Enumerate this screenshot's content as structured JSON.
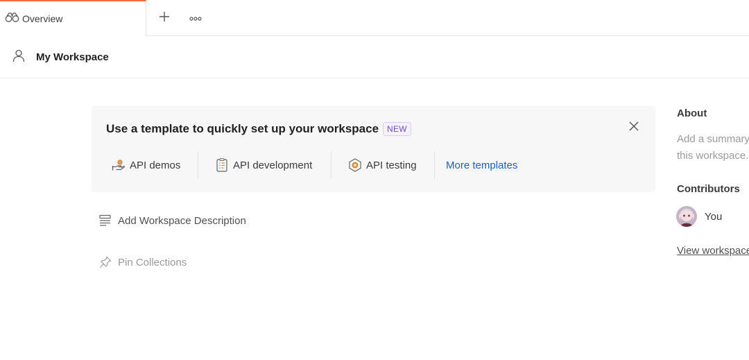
{
  "tabs": {
    "active": {
      "label": "Overview",
      "icon": "binoculars-icon"
    },
    "add_icon": "plus-icon",
    "more_icon": "ellipsis-icon"
  },
  "workspace": {
    "title": "My Workspace",
    "icon": "user-icon"
  },
  "banner": {
    "title": "Use a template to quickly set up your workspace",
    "badge": "NEW",
    "close_icon": "close-icon",
    "templates": [
      {
        "label": "API demos",
        "icon": "hand-coin-icon"
      },
      {
        "label": "API development",
        "icon": "clipboard-list-icon"
      },
      {
        "label": "API testing",
        "icon": "gear-hexagon-icon"
      }
    ],
    "more_label": "More templates"
  },
  "actions": {
    "description": {
      "label": "Add Workspace Description",
      "icon": "text-lines-icon"
    },
    "pin": {
      "label": "Pin Collections",
      "icon": "pin-icon"
    }
  },
  "sidebar": {
    "about_heading": "About",
    "about_text": "Add a summary of this workspace.",
    "contributors_heading": "Contributors",
    "contributor_name": "You",
    "view_link": "View workspace activity"
  },
  "colors": {
    "accent": "#f26b3a",
    "link": "#1f5fbf",
    "badge": "#6b4fbb"
  }
}
